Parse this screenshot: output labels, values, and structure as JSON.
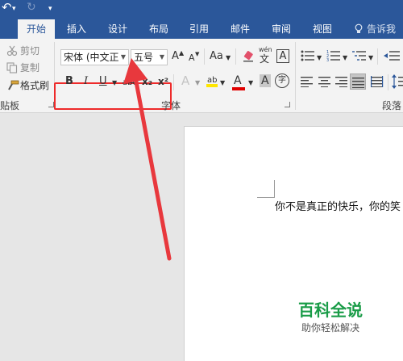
{
  "window": {
    "qat": {
      "undo_glyph": "↶",
      "dropdown_glyph": "▾",
      "redo_glyph": "↻",
      "more_glyph": "▾"
    },
    "tabs": [
      "开始",
      "插入",
      "设计",
      "布局",
      "引用",
      "邮件",
      "审阅",
      "视图"
    ],
    "active_tab": "开始",
    "tell_me": "告诉我"
  },
  "clipboard": {
    "cut": "剪切",
    "copy": "复制",
    "format_painter": "格式刷",
    "group_label": "贴板"
  },
  "font": {
    "font_name": "宋体 (中文正",
    "font_size": "五号",
    "grow_font": "A",
    "shrink_font": "A",
    "change_case": "Aa",
    "phonetic_top": "wén",
    "phonetic_bottom": "文",
    "char_border": "A",
    "bold": "B",
    "italic": "I",
    "underline": "U",
    "strikethrough": "abc",
    "subscript": "x₂",
    "superscript": "x²",
    "text_effects": "A",
    "font_color": "A",
    "shading": "A",
    "enclose": "字",
    "group_label": "字体"
  },
  "paragraph": {
    "group_label": "段落"
  },
  "document": {
    "body_text": "你不是真正的快乐，你的笑"
  },
  "watermark": {
    "title": "百科全说",
    "subtitle": "助你轻松解决"
  },
  "colors": {
    "ribbon_blue": "#2b579a",
    "highlight_red": "#ee2a2a",
    "arrow_red": "#e8383d",
    "watermark_green": "#1a9c48",
    "highlighter_yellow": "#ffe600",
    "font_color_red": "#e00000"
  }
}
